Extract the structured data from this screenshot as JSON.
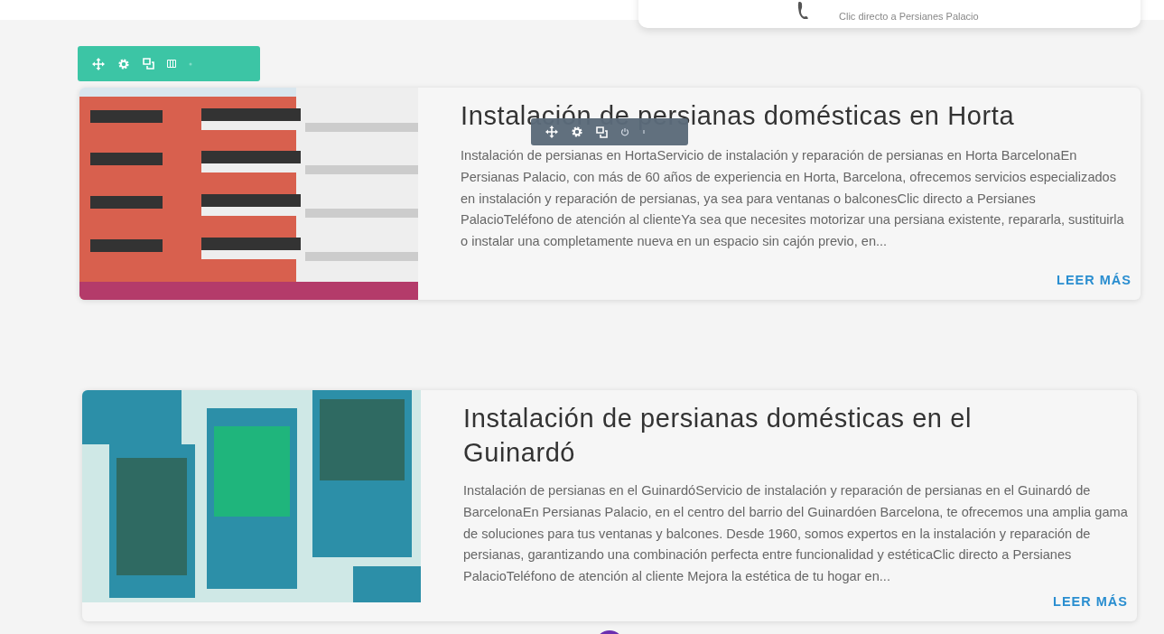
{
  "top_card": {
    "caption": "Clic directo a Persianes Palacio"
  },
  "posts": [
    {
      "title": "Instalación de persianas domésticas en Horta",
      "excerpt": "Instalación de persianas en HortaServicio de instalación y reparación de persianas en Horta BarcelonaEn Persianas Palacio, con más de 60 años de experiencia en Horta, Barcelona, ofrecemos servicios especializados en instalación y reparación de persianas, ya sea para ventanas o balconesClic directo a Persianes PalacioTeléfono de atención al clienteYa sea que necesites motorizar una persiana existente, repararla, sustituirla o instalar una completamente nueva en un espacio sin cajón previo, en...",
      "read_more": "LEER MÁS",
      "kind": "building"
    },
    {
      "title": "Instalación de persianas domésticas en el Guinardó",
      "excerpt": "Instalación de persianas en el GuinardóServicio de instalación y reparación de persianas en el Guinardó de BarcelonaEn Persianas Palacio, en el centro del barrio del Guinardóen Barcelona, te ofrecemos una amplia gama de soluciones para tus ventanas y balcones. Desde 1960, somos expertos en la instalación y reparación de persianas, garantizando una combinación perfecta entre funcionalidad y estéticaClic directo a Persianes PalacioTeléfono de atención al cliente Mejora la estética de tu hogar en...",
      "read_more": "LEER MÁS",
      "kind": "windows"
    }
  ]
}
